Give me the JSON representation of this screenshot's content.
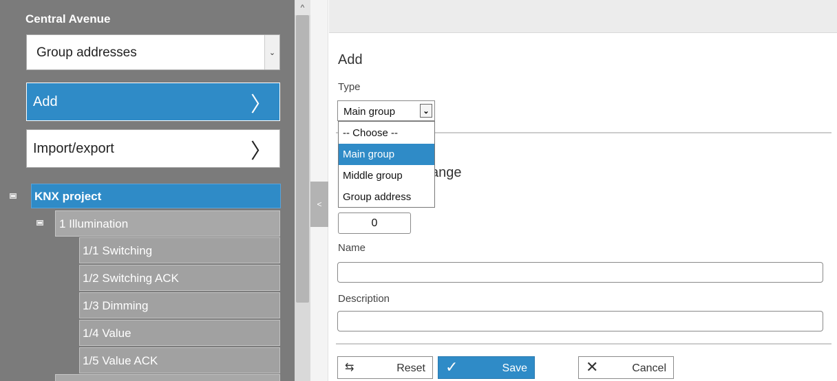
{
  "sidebar": {
    "title": "Central Avenue",
    "group_select": {
      "value": "Group addresses",
      "arrow_icon": "chevron-down-icon"
    },
    "buttons": [
      {
        "label": "Add",
        "icon": "chevron-right-icon",
        "active": true
      },
      {
        "label": "Import/export",
        "icon": "chevron-right-icon",
        "active": false
      }
    ],
    "tree": {
      "root": "KNX project",
      "main_group": "1 Illumination",
      "items": [
        "1/1 Switching",
        "1/2 Switching ACK",
        "1/3 Dimming",
        "1/4 Value",
        "1/5 Value ACK"
      ]
    }
  },
  "scrollbar": {
    "up_glyph": "^"
  },
  "collapse": {
    "glyph": "<"
  },
  "form": {
    "title": "Add",
    "type_label": "Type",
    "type_value": "Main group",
    "type_options": [
      "-- Choose --",
      "Main group",
      "Middle group",
      "Group address"
    ],
    "type_selected_index": 1,
    "partial_heading": "ange",
    "range_value": "0",
    "name_label": "Name",
    "name_value": "",
    "description_label": "Description",
    "description_value": ""
  },
  "actions": {
    "reset": {
      "label": "Reset",
      "icon": "reset-icon"
    },
    "save": {
      "label": "Save",
      "icon": "checkmark-icon"
    },
    "cancel": {
      "label": "Cancel",
      "icon": "close-icon"
    }
  },
  "colors": {
    "accent": "#2f8bc7",
    "sidebar_bg": "#7b7b7b"
  }
}
